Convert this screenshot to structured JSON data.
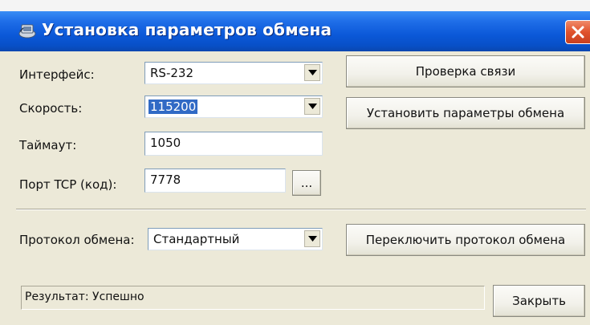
{
  "window": {
    "title": "Установка параметров обмена",
    "title_icon": "network-settings-icon",
    "close_icon": "close-icon"
  },
  "form": {
    "interface": {
      "label": "Интерфейс:",
      "value": "RS-232"
    },
    "speed": {
      "label": "Скорость:",
      "value": "115200"
    },
    "timeout": {
      "label": "Таймаут:",
      "value": "1050"
    },
    "tcp_port": {
      "label": "Порт TCP (код):",
      "value": "7778",
      "browse_label": "..."
    },
    "protocol": {
      "label": "Протокол обмена:",
      "value": "Стандартный"
    }
  },
  "buttons": {
    "check_connection": "Проверка связи",
    "set_parameters": "Установить параметры обмена",
    "switch_protocol": "Переключить протокол обмена",
    "close": "Закрыть"
  },
  "status": {
    "text": "Результат: Успешно"
  },
  "colors": {
    "titlebar": "#0b58d8",
    "window_bg": "#ece9d8",
    "selection": "#316ac5",
    "close_button": "#e0522c"
  }
}
